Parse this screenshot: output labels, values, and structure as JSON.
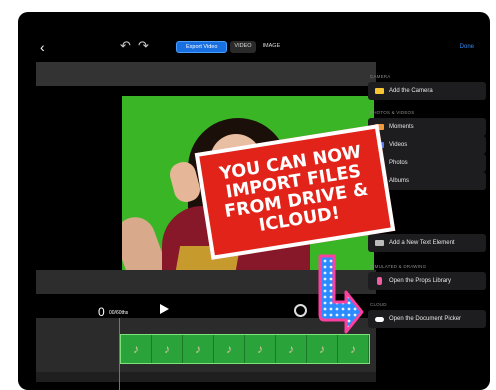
{
  "toolbar": {
    "back_icon": "chevron-left-icon",
    "undo_icon": "undo-icon",
    "redo_icon": "redo-icon",
    "segments": [
      "Export Video",
      "VIDEO",
      "IMAGE"
    ],
    "done_label": "Done"
  },
  "playback": {
    "time": "0",
    "fraction": "00/60ths",
    "unit": "seconds"
  },
  "panel": {
    "camera_header": "CAMERA",
    "add_camera": "Add the Camera",
    "photos_header": "PHOTOS & VIDEOS",
    "moments": "Moments",
    "videos": "Videos",
    "photos": "Photos",
    "albums": "Albums",
    "text_label": "Add a New Text Element",
    "props_header": "SIMULATED & DRAWING",
    "props_label": "Open the Props Library",
    "cloud_header": "CLOUD",
    "cloud_label": "Open the Document Picker"
  },
  "overlay": {
    "line1": "YOU CAN NOW",
    "line2": "IMPORT FILES",
    "line3": "FROM DRIVE &",
    "line4": "ICLOUD!"
  },
  "colors": {
    "accent": "#1a6fe0",
    "green_screen": "#3ab526",
    "banner_red": "#e2231a",
    "playhead": "#ff3b2f"
  }
}
